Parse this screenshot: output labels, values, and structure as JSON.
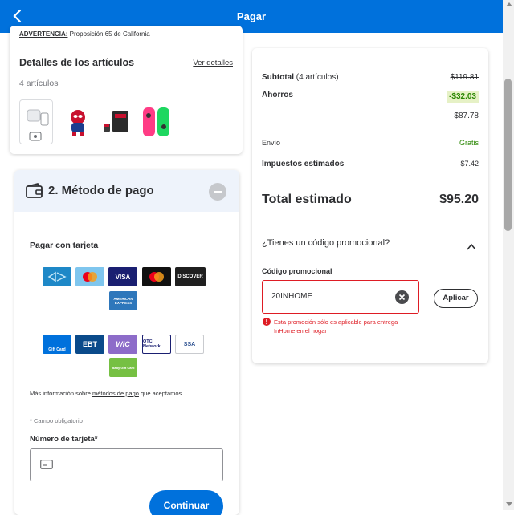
{
  "header": {
    "title": "Pagar",
    "back_icon": "chevron-left-icon",
    "bg_color": "#0071dc"
  },
  "items": {
    "warning_label": "ADVERTENCIA:",
    "warning_text": " Proposición 65 de California",
    "title": "Detalles de los artículos",
    "details_link": "Ver detalles",
    "count": "4 artículos",
    "thumbnails": [
      "smart-plug-kit",
      "spiderman-toy",
      "sd-card",
      "joy-con-controllers"
    ]
  },
  "payment": {
    "title": "2. Método de pago",
    "pay_with_card": "Pagar con tarjeta",
    "card_logos": [
      "Capital One",
      "Mastercard",
      "VISA",
      "Mastercard",
      "DISCOVER",
      "AMERICAN EXPRESS"
    ],
    "other_logos": [
      "Gift Card",
      "EBT",
      "WIC",
      "OTC Network",
      "SSA",
      "Baby Gift Card"
    ],
    "more_info_prefix": "Más información sobre ",
    "more_info_link": "métodos de pago",
    "more_info_suffix": " que aceptamos.",
    "required_note": "* Campo obligatorio",
    "card_number_label": "Número de tarjeta*",
    "card_number_value": "",
    "continue_label": "Continuar"
  },
  "summary": {
    "subtotal_label": "Subtotal",
    "subtotal_count": " (4 artículos)",
    "subtotal_original": "$119.81",
    "savings_label": "Ahorros",
    "savings_value": "-$32.03",
    "subtotal_after": "$87.78",
    "shipping_label": "Envío",
    "shipping_value": "Gratis",
    "tax_label": "Impuestos estimados",
    "tax_value": "$7.42",
    "total_label": "Total estimado",
    "total_value": "$95.20",
    "promo_question": "¿Tienes un código promocional?",
    "promo_label": "Código promocional",
    "promo_value": "20INHOME",
    "apply_label": "Aplicar",
    "error_text": "Esta promoción sólo es aplicable para entrega InHome en el hogar",
    "colors": {
      "savings": "#2a8703",
      "error": "#de1c24",
      "accent": "#0071dc"
    }
  }
}
